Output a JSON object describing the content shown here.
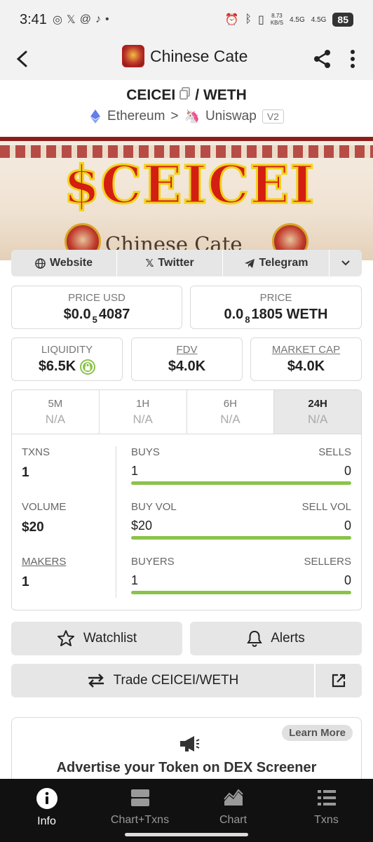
{
  "status": {
    "time": "3:41",
    "net_speed": "8.73",
    "net_unit": "KB/S",
    "sim1": "4.5G",
    "sim2": "4.5G",
    "battery": "85"
  },
  "header": {
    "title": "Chinese Cate"
  },
  "pair": {
    "base": "CEICEI",
    "separator": "/",
    "quote": "WETH",
    "chain": "Ethereum",
    "arrow": ">",
    "dex": "Uniswap",
    "version": "V2"
  },
  "banner": {
    "title": "$CEICEI",
    "subtitle": "Chinese Cate"
  },
  "links": {
    "website": "Website",
    "twitter": "Twitter",
    "telegram": "Telegram"
  },
  "price_usd": {
    "label": "PRICE USD",
    "prefix": "$0.0",
    "sub": "5",
    "suffix": "4087"
  },
  "price_native": {
    "label": "PRICE",
    "prefix": "0.0",
    "sub": "8",
    "suffix": "1805 WETH"
  },
  "liquidity": {
    "label": "LIQUIDITY",
    "value": "$6.5K"
  },
  "fdv": {
    "label": "FDV",
    "value": "$4.0K"
  },
  "market_cap": {
    "label": "MARKET CAP",
    "value": "$4.0K"
  },
  "timeframes": [
    {
      "name": "5M",
      "value": "N/A"
    },
    {
      "name": "1H",
      "value": "N/A"
    },
    {
      "name": "6H",
      "value": "N/A"
    },
    {
      "name": "24H",
      "value": "N/A"
    }
  ],
  "stats": {
    "txns": {
      "label": "TXNS",
      "value": "1"
    },
    "volume": {
      "label": "VOLUME",
      "value": "$20"
    },
    "makers": {
      "label": "MAKERS",
      "value": "1"
    },
    "buys": {
      "label": "BUYS",
      "value": "1",
      "sell_label": "SELLS",
      "sell_value": "0",
      "buy_fraction": 1.0
    },
    "buy_vol": {
      "label": "BUY VOL",
      "value": "$20",
      "sell_label": "SELL VOL",
      "sell_value": "0",
      "buy_fraction": 1.0
    },
    "buyers": {
      "label": "BUYERS",
      "value": "1",
      "sell_label": "SELLERS",
      "sell_value": "0",
      "buy_fraction": 1.0
    }
  },
  "actions": {
    "watchlist": "Watchlist",
    "alerts": "Alerts",
    "trade": "Trade CEICEI/WETH"
  },
  "ad": {
    "learn_more": "Learn More",
    "text": "Advertise your Token on DEX Screener"
  },
  "nav": {
    "info": "Info",
    "chart_txns": "Chart+Txns",
    "chart": "Chart",
    "txns": "Txns"
  },
  "colors": {
    "accent_green": "#8bc34a",
    "banner_red": "#d41e12"
  }
}
